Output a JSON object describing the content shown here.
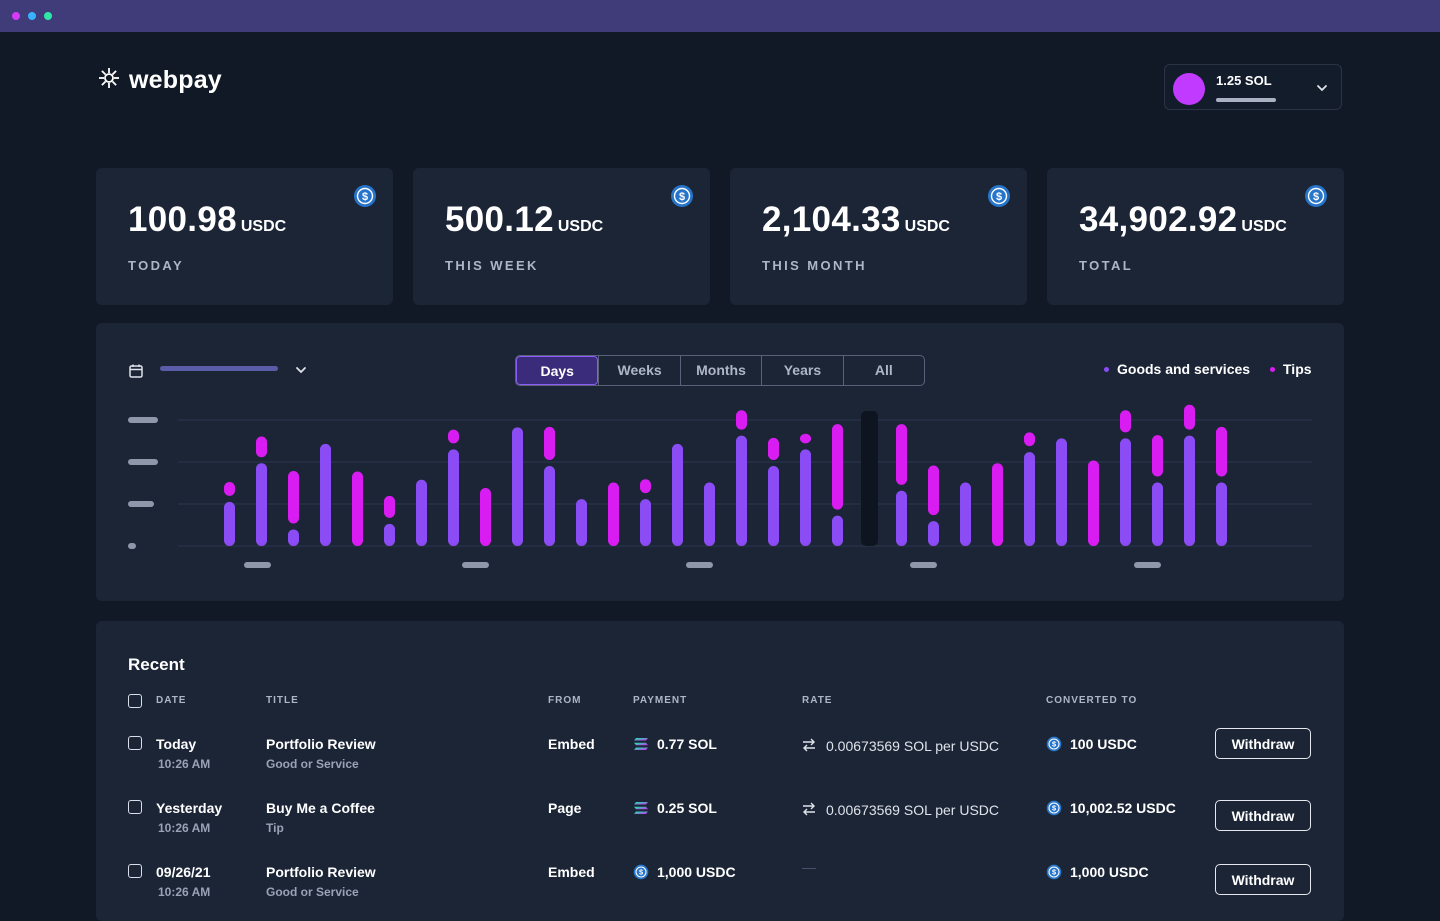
{
  "app": {
    "name": "webpay"
  },
  "colors": {
    "background": "#111927",
    "card": "#1b2536",
    "goods": "#8b4cf6",
    "tips": "#d91df2",
    "usdc": "#2775ca"
  },
  "wallet": {
    "balance": "1.25 SOL"
  },
  "stats": [
    {
      "amount": "100.98",
      "unit": "USDC",
      "label": "TODAY"
    },
    {
      "amount": "500.12",
      "unit": "USDC",
      "label": "THIS WEEK"
    },
    {
      "amount": "2,104.33",
      "unit": "USDC",
      "label": "THIS MONTH"
    },
    {
      "amount": "34,902.92",
      "unit": "USDC",
      "label": "TOTAL"
    }
  ],
  "chart": {
    "tabs": [
      "Days",
      "Weeks",
      "Months",
      "Years",
      "All"
    ],
    "active_tab": "Days",
    "legend": [
      "Goods and services",
      "Tips"
    ]
  },
  "chart_data": {
    "type": "bar",
    "stacked": true,
    "x_labels_hidden": true,
    "y_labels_hidden": true,
    "highlighted_index": 20,
    "series": [
      {
        "name": "Goods and services",
        "values": [
          0.32,
          0.6,
          0.12,
          0.74,
          0,
          0.16,
          0.48,
          0.7,
          0,
          0.86,
          0.58,
          0.34,
          0,
          0.34,
          0.74,
          0.46,
          0.8,
          0.58,
          0.7,
          0.22,
          0,
          0.4,
          0.18,
          0.46,
          0,
          0.68,
          0.78,
          0,
          0.78,
          0.46,
          0.8,
          0.46
        ]
      },
      {
        "name": "Tips",
        "values": [
          0.1,
          0.15,
          0.38,
          0,
          0.54,
          0.16,
          0,
          0.1,
          0.42,
          0,
          0.24,
          0,
          0.46,
          0.1,
          0,
          0,
          0.14,
          0.16,
          0.07,
          0.62,
          0,
          0.44,
          0.36,
          0,
          0.6,
          0.1,
          0,
          0.62,
          0.16,
          0.3,
          0.18,
          0.36
        ]
      }
    ]
  },
  "recent": {
    "title": "Recent",
    "headers": {
      "date": "DATE",
      "title": "TITLE",
      "from": "FROM",
      "payment": "PAYMENT",
      "rate": "RATE",
      "converted": "CONVERTED TO"
    },
    "withdraw_label": "Withdraw",
    "rows": [
      {
        "date": "Today",
        "time": "10:26 AM",
        "title": "Portfolio Review",
        "category": "Good or Service",
        "from": "Embed",
        "payment": "0.77 SOL",
        "payment_icon": "solana-icon",
        "rate": "0.00673569 SOL per USDC",
        "converted": "100 USDC"
      },
      {
        "date": "Yesterday",
        "time": "10:26 AM",
        "title": "Buy Me a Coffee",
        "category": "Tip",
        "from": "Page",
        "payment": "0.25 SOL",
        "payment_icon": "solana-icon",
        "rate": "0.00673569 SOL per USDC",
        "converted": "10,002.52 USDC"
      },
      {
        "date": "09/26/21",
        "time": "10:26 AM",
        "title": "Portfolio Review",
        "category": "Good or Service",
        "from": "Embed",
        "payment": "1,000 USDC",
        "payment_icon": "usdc-icon",
        "rate": "—",
        "converted": "1,000 USDC"
      }
    ]
  }
}
